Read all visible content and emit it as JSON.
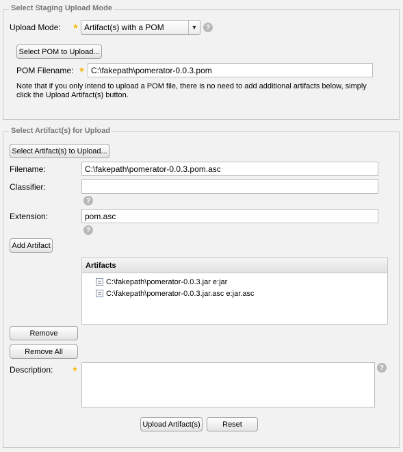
{
  "staging_mode": {
    "legend": "Select Staging Upload Mode",
    "upload_mode_label": "Upload Mode:",
    "upload_mode_value": "Artifact(s) with a POM",
    "select_pom_button": "Select POM to Upload...",
    "pom_filename_label": "POM Filename:",
    "pom_filename_value": "C:\\fakepath\\pomerator-0.0.3.pom",
    "note_line1": "Note that if you only intend to upload a POM file, there is no need to add additional artifacts below, simply",
    "note_line2": "click the Upload Artifact(s) button."
  },
  "artifacts_section": {
    "legend": "Select Artifact(s) for Upload",
    "select_artifacts_button": "Select Artifact(s) to Upload...",
    "filename_label": "Filename:",
    "filename_value": "C:\\fakepath\\pomerator-0.0.3.pom.asc",
    "classifier_label": "Classifier:",
    "classifier_value": "",
    "extension_label": "Extension:",
    "extension_value": "pom.asc",
    "add_artifact_button": "Add Artifact",
    "grid_header": "Artifacts",
    "artifacts": [
      "C:\\fakepath\\pomerator-0.0.3.jar e:jar",
      "C:\\fakepath\\pomerator-0.0.3.jar.asc e:jar.asc"
    ],
    "remove_button": "Remove",
    "remove_all_button": "Remove All",
    "description_label": "Description:",
    "description_value": ""
  },
  "footer": {
    "upload_button": "Upload Artifact(s)",
    "reset_button": "Reset"
  },
  "icons": {
    "required": "required-star-icon",
    "help": "help-icon",
    "file": "file-icon",
    "dropdown": "chevron-down-icon"
  },
  "colors": {
    "background": "#f2f2f2",
    "required_star": "#f5b800",
    "help_icon": "#b8b8b8"
  }
}
